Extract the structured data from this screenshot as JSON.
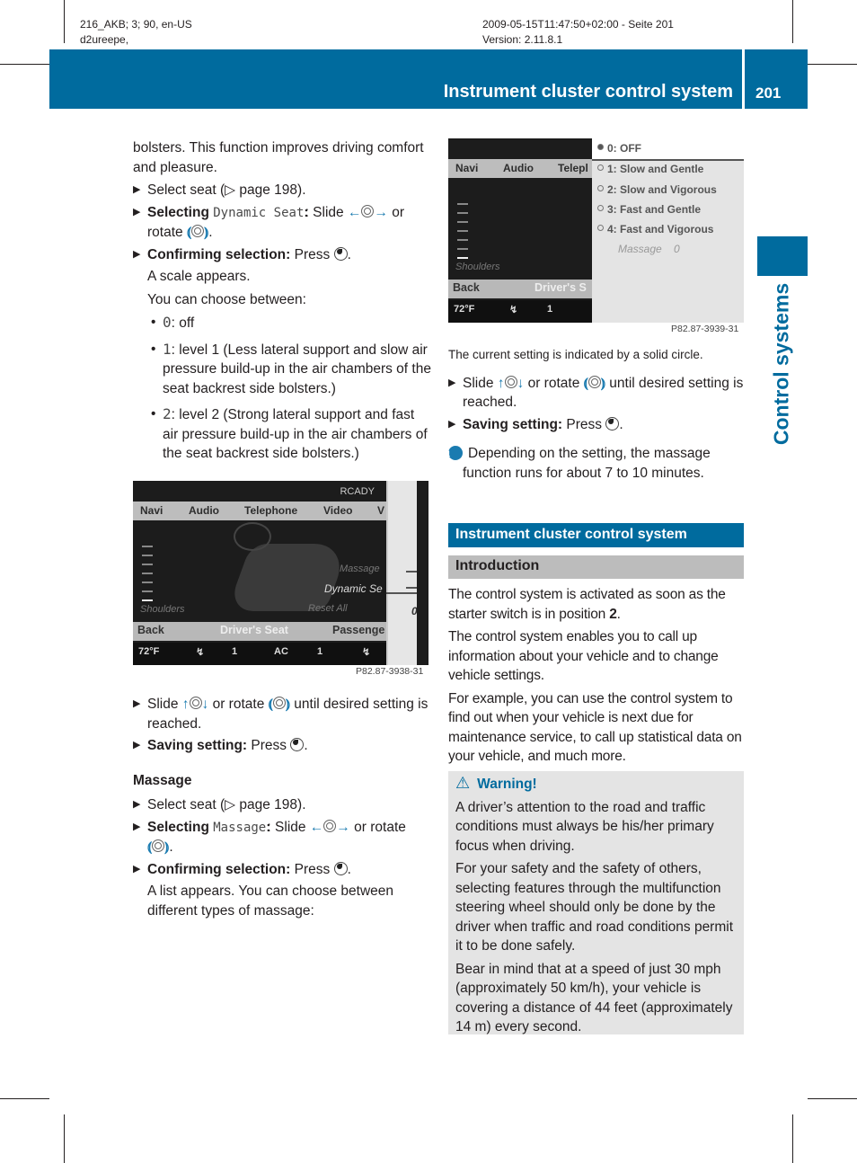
{
  "print_meta": {
    "left_line1": "216_AKB; 3; 90, en-US",
    "left_line2": "d2ureepe,",
    "right_line1": "2009-05-15T11:47:50+02:00 - Seite 201",
    "right_line2": "Version: 2.11.8.1"
  },
  "header": {
    "title": "Instrument cluster control system",
    "page_number": "201",
    "color": "#006b9e"
  },
  "side_tab": {
    "label": "Control systems"
  },
  "left_column": {
    "intro": "bolsters. This function improves driving comfort and pleasure.",
    "steps_dynamic": [
      {
        "text": "Select seat (▷ page 198)."
      },
      {
        "bold": "Selecting",
        "mono": "Dynamic Seat",
        "after_mono": ": Slide",
        "after_icon": "or",
        "line2_pre": "rotate",
        "line2_post": "."
      },
      {
        "bold": "Confirming selection:",
        "text": "Press",
        "after": "."
      }
    ],
    "scale_appears": "A scale appears.",
    "choose_between": "You can choose between:",
    "options": [
      {
        "value": "0",
        "text": ": off"
      },
      {
        "value": "1",
        "text": ": level 1 (Less lateral support and slow air pressure build-up in the air chambers of the seat backrest side bolsters.)"
      },
      {
        "value": "2",
        "text": ": level 2 (Strong lateral support and fast air pressure build-up in the air chambers of the seat backrest side bolsters.)"
      }
    ],
    "screen1": {
      "status_top": "RCADY",
      "menu": [
        "Navi",
        "Audio",
        "Telephone",
        "Video",
        "V"
      ],
      "labels": {
        "massage": "Massage",
        "dynamic_seat": "Dynamic Se",
        "reset_all": "Reset All",
        "shoulders": "Shoulders"
      },
      "footer": [
        "Back",
        "Driver's Seat",
        "Passenge"
      ],
      "status": [
        "72°F",
        "seat-heat",
        "1",
        "AC",
        "1",
        "seat-heat"
      ],
      "scale_value": "0",
      "dynamic_seat_level": 0,
      "caption": "P82.87-3938-31"
    },
    "slide_step": {
      "pre": "Slide",
      "mid": "or rotate",
      "post": "until desired setting is reached."
    },
    "saving_step": {
      "bold": "Saving setting:",
      "text": "Press",
      "after": "."
    },
    "massage_heading": "Massage",
    "steps_massage": [
      {
        "text": "Select seat (▷ page 198)."
      },
      {
        "bold": "Selecting",
        "mono": "Massage",
        "after_mono": ": Slide",
        "after_icon": "or rotate",
        "line2_post": "."
      },
      {
        "bold": "Confirming selection:",
        "text": "Press",
        "after": "."
      }
    ],
    "list_appears": "A list appears. You can choose between different types of massage:"
  },
  "right_column": {
    "screen2": {
      "menu": [
        "Navi",
        "Audio",
        "Telepl"
      ],
      "shoulders": "Shoulders",
      "footer": [
        "Back",
        "Driver's S"
      ],
      "status": [
        "72°F",
        "seat-heat",
        "1"
      ],
      "options": [
        {
          "label": "0: OFF",
          "selected": true
        },
        {
          "label": "1: Slow and Gentle",
          "selected": false
        },
        {
          "label": "2: Slow and Vigorous",
          "selected": false
        },
        {
          "label": "3: Fast and Gentle",
          "selected": false
        },
        {
          "label": "4: Fast and Vigorous",
          "selected": false
        }
      ],
      "massage_label": "Massage",
      "massage_value": "0",
      "caption": "P82.87-3939-31"
    },
    "solid_circle_note": "The current setting is indicated by a solid circle.",
    "slide_step": {
      "pre": "Slide",
      "mid": "or rotate",
      "post": "until desired setting is reached."
    },
    "saving_step": {
      "bold": "Saving setting:",
      "text": "Press",
      "after": "."
    },
    "info_note": "Depending on the setting, the massage function runs for about 7 to 10 minutes.",
    "section_title": "Instrument cluster control system",
    "subsection_title": "Introduction",
    "intro_p1_pre": "The control system is activated as soon as the starter switch is in position ",
    "intro_p1_bold": "2",
    "intro_p1_post": ".",
    "intro_p2": "The control system enables you to call up information about your vehicle and to change vehicle settings.",
    "intro_p3": "For example, you can use the control system to find out when your vehicle is next due for maintenance service, to call up statistical data on your vehicle, and much more.",
    "warning": {
      "title": "Warning!",
      "paragraphs": [
        "A driver’s attention to the road and traffic conditions must always be his/her primary focus when driving.",
        "For your safety and the safety of others, selecting features through the multifunction steering wheel should only be done by the driver when traffic and road conditions permit it to be done safely.",
        "Bear in mind that at a speed of just 30 mph (approximately 50 km/h), your vehicle is covering a distance of 44 feet (approximately 14 m) every second."
      ]
    }
  }
}
